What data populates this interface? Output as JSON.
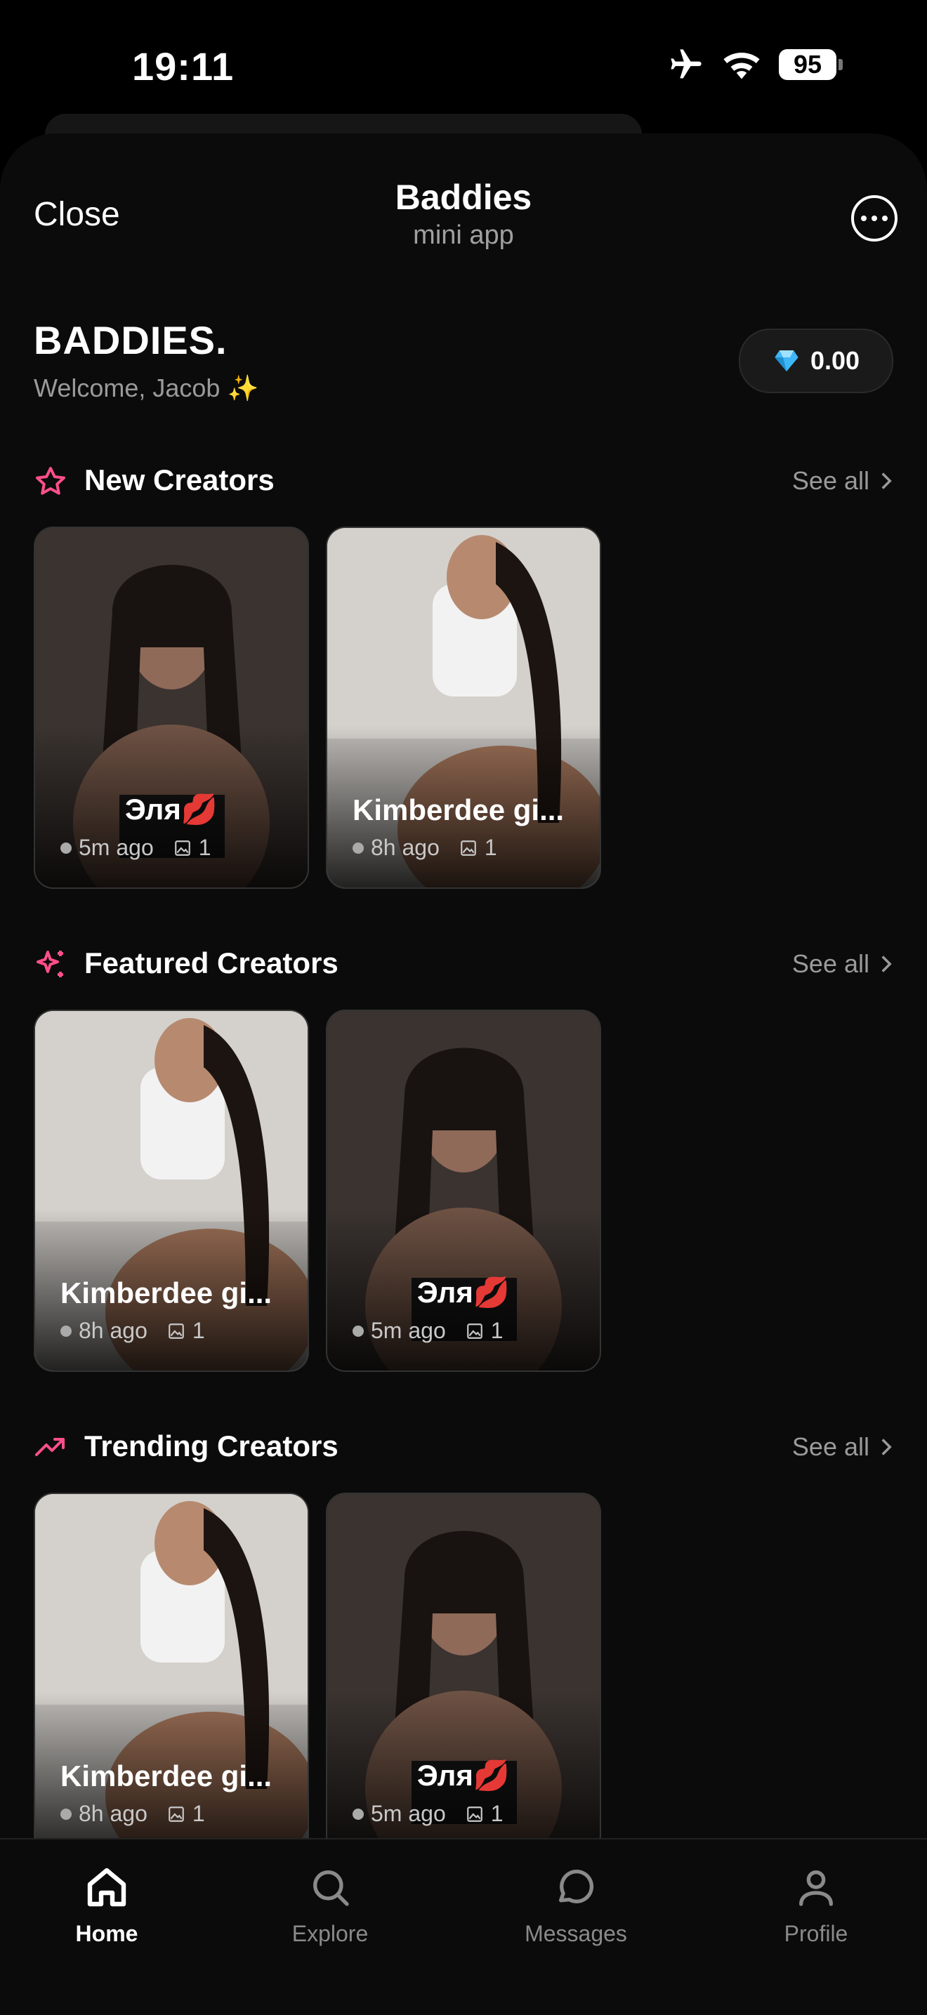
{
  "status_bar": {
    "time": "19:11",
    "battery": "95"
  },
  "header": {
    "close_label": "Close",
    "title": "Baddies",
    "subtitle": "mini app"
  },
  "brand": {
    "name": "BADDIES.",
    "welcome": "Welcome, Jacob ✨"
  },
  "balance": {
    "amount": "0.00"
  },
  "sections": [
    {
      "title": "New Creators",
      "see_all": "See all",
      "icon": "star-icon",
      "cards": [
        {
          "name": "Эля💋",
          "time": "5m ago",
          "count": "1",
          "photo": "dark"
        },
        {
          "name": "Kimberdee gi...",
          "time": "8h ago",
          "count": "1",
          "photo": "light"
        }
      ]
    },
    {
      "title": "Featured Creators",
      "see_all": "See all",
      "icon": "sparkles-icon",
      "cards": [
        {
          "name": "Kimberdee gi...",
          "time": "8h ago",
          "count": "1",
          "photo": "light"
        },
        {
          "name": "Эля💋",
          "time": "5m ago",
          "count": "1",
          "photo": "dark"
        }
      ]
    },
    {
      "title": "Trending Creators",
      "see_all": "See all",
      "icon": "trending-up-icon",
      "cards": [
        {
          "name": "Kimberdee gi...",
          "time": "8h ago",
          "count": "1",
          "photo": "light"
        },
        {
          "name": "Эля💋",
          "time": "5m ago",
          "count": "1",
          "photo": "dark"
        }
      ]
    }
  ],
  "tabbar": {
    "items": [
      {
        "label": "Home",
        "icon": "home-icon",
        "active": true
      },
      {
        "label": "Explore",
        "icon": "search-icon",
        "active": false
      },
      {
        "label": "Messages",
        "icon": "chat-bubble-icon",
        "active": false
      },
      {
        "label": "Profile",
        "icon": "user-icon",
        "active": false
      }
    ]
  },
  "colors": {
    "accent": "#ff4f8b",
    "background": "#0b0b0b"
  }
}
